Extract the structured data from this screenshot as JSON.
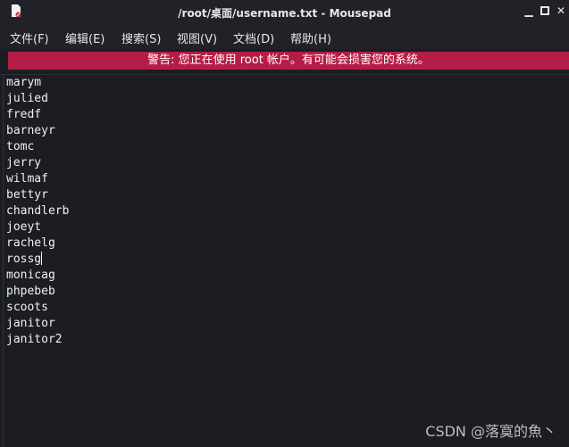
{
  "window": {
    "title": "/root/桌面/username.txt - Mousepad",
    "minimize_icon": "minimize-icon",
    "maximize_icon": "maximize-icon",
    "close_icon": "close-icon"
  },
  "menu": {
    "items": [
      "文件(F)",
      "编辑(E)",
      "搜索(S)",
      "视图(V)",
      "文档(D)",
      "帮助(H)"
    ]
  },
  "warning": {
    "text": "警告: 您正在使用 root 帐户。有可能会损害您的系统。",
    "color": "#b61d46"
  },
  "editor": {
    "lines": [
      "marym",
      "julied",
      "fredf",
      "barneyr",
      "tomc",
      "jerry",
      "wilmaf",
      "bettyr",
      "chandlerb",
      "joeyt",
      "rachelg",
      "rossg",
      "monicag",
      "phpebeb",
      "scoots",
      "janitor",
      "janitor2"
    ]
  },
  "watermark": "CSDN @落寞的魚丶"
}
